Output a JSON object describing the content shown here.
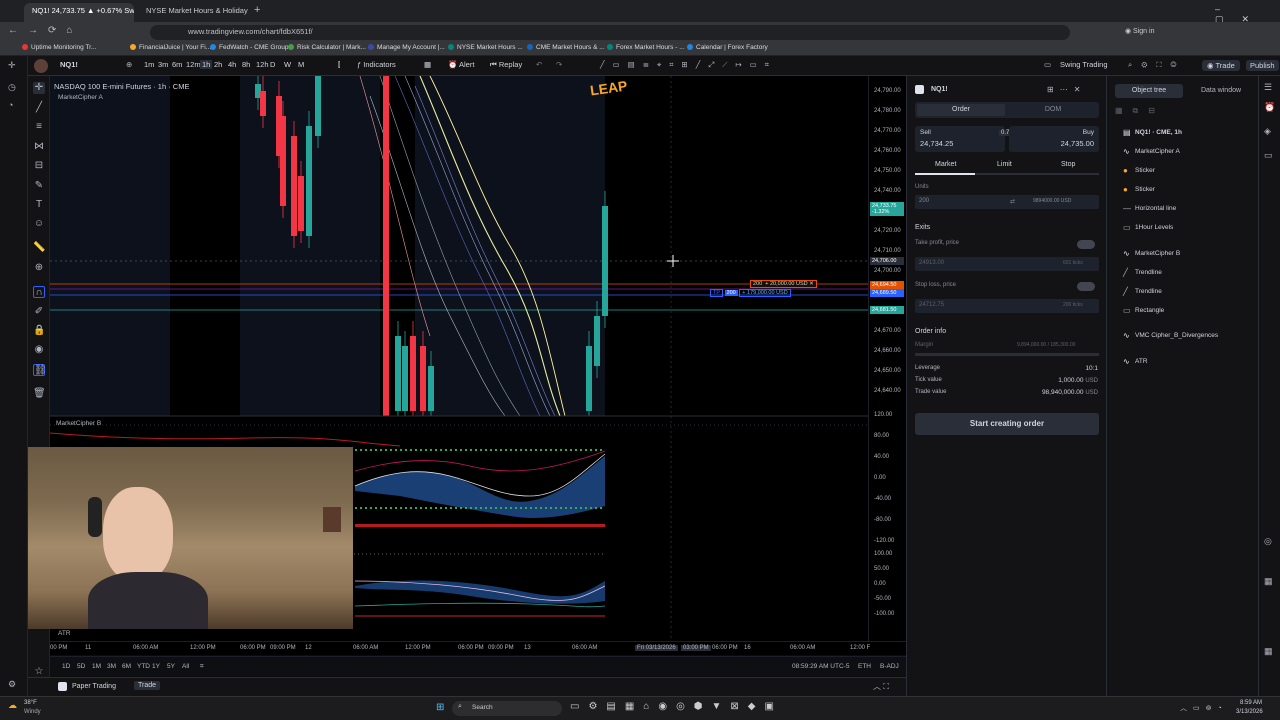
{
  "browser": {
    "tabs": [
      {
        "label": "NQ1! 24,733.75 ▲ +0.67% Swi"
      },
      {
        "label": "NYSE Market Hours & Holiday"
      }
    ],
    "url": "www.tradingview.com/chart/fdbX651f/"
  },
  "bookmarks": [
    "Uptime Monitoring Tr...",
    "FinancialJuice | Your Fi...",
    "FedWatch - CME Group",
    "Risk Calculator | Mark...",
    "Manage My Account |...",
    "NYSE Market Hours ...",
    "CME Market Hours & ...",
    "Forex Market Hours - ...",
    "Calendar | Forex Factory"
  ],
  "toolbar": {
    "symbol": "NQ1!",
    "intervals": [
      "1m",
      "3m",
      "6m",
      "12m",
      "1h",
      "2h",
      "4h",
      "8h",
      "12h",
      "D",
      "W",
      "M"
    ],
    "active_interval": "1h",
    "indicators": "Indicators",
    "alert": "Alert",
    "replay": "Replay",
    "layout": "Swing Trading",
    "layout_sub": "Save",
    "trade": "Trade",
    "publish": "Publish"
  },
  "chart": {
    "title": "NASDAQ 100 E-mini Futures · 1h · CME",
    "indicator_a": "MarketCipher A",
    "indicator_b": "MarketCipher B",
    "atr": "ATR",
    "logo": "LEAP",
    "order_line1_qty": "200",
    "order_line1_text": "+ 20,000.00 USD",
    "order_line2_qty": "200",
    "order_line2_tp": "TP",
    "order_line2_text": "+ 179,000.00 USD",
    "prices": [
      "24,790.00",
      "24,780.00",
      "24,770.00",
      "24,760.00",
      "24,750.00",
      "24,740.00",
      "24,730.00",
      "24,720.00",
      "24,710.00",
      "24,700.00",
      "24,690.00",
      "24,680.00",
      "24,670.00",
      "24,660.00",
      "24,650.00",
      "24,640.00"
    ],
    "price_tags": [
      {
        "label": "24,733.75",
        "sub": "-1.32%",
        "color": "#26a69a"
      },
      {
        "label": "24,706.00",
        "color": "#2a2e39"
      },
      {
        "label": "24,694.50",
        "color": "#e65100"
      },
      {
        "label": "24,689.50",
        "color": "#2962ff"
      },
      {
        "label": "24,681.50",
        "color": "#26a69a"
      }
    ],
    "osc_levels": [
      "120.00",
      "80.00",
      "40.00",
      "0.00",
      "-40.00",
      "-80.00",
      "-120.00"
    ],
    "osc2_levels": [
      "100.00",
      "50.00",
      "0.00",
      "-50.00",
      "-100.00"
    ],
    "time_labels": [
      "00 PM",
      "11",
      "06:00 AM",
      "12:00 PM",
      "06:00 PM",
      "09:00 PM",
      "12",
      "06:00 AM",
      "12:00 PM",
      "06:00 PM",
      "09:00 PM",
      "13",
      "06:00 AM",
      "Fri 03/13/2026",
      "03:00 PM",
      "06:00 PM",
      "16",
      "06:00 AM",
      "12:00 F"
    ],
    "ranges": [
      "1D",
      "5D",
      "1M",
      "3M",
      "6M",
      "YTD",
      "1Y",
      "5Y",
      "All"
    ],
    "clock": "08:59:29 AM UTC-5",
    "session": "ETH",
    "adj": "B-ADJ"
  },
  "order": {
    "symbol": "NQ1!",
    "tabs": [
      "Order",
      "DOM"
    ],
    "sell_label": "Sell",
    "sell_price": "24,734.25",
    "spread": "0.75",
    "buy_label": "Buy",
    "buy_price": "24,735.00",
    "types": [
      "Market",
      "Limit",
      "Stop"
    ],
    "units_label": "Units",
    "units_value": "200",
    "units_usd": "9894000.00 USD",
    "exits": "Exits",
    "tp_label": "Take profit, price",
    "tp_value": "24913.00",
    "tp_ticks": "601 ticks",
    "sl_label": "Stop loss, price",
    "sl_value": "24712.75",
    "sl_ticks": "200 ticks",
    "info_title": "Order info",
    "margin_label": "Margin",
    "margin_value": "9,894,000.00 / 185,300.00",
    "leverage_label": "Leverage",
    "leverage_value": "10:1",
    "tick_label": "Tick value",
    "tick_value": "1,000.00",
    "tick_unit": "USD",
    "trade_label": "Trade value",
    "trade_value": "98,940,000.00",
    "trade_unit": "USD",
    "submit": "Start creating order"
  },
  "objects": {
    "tabs": [
      "Object tree",
      "Data window"
    ],
    "items": [
      "NQ1! · CME, 1h",
      "MarketCipher A",
      "Sticker",
      "Sticker",
      "Horizontal line",
      "1Hour Levels",
      "MarketCipher B",
      "Trendline",
      "Trendline",
      "Rectangle",
      "VMC Cipher_B_Divergences",
      "ATR"
    ]
  },
  "bottom": {
    "paper": "Paper Trading",
    "trade": "Trade"
  },
  "taskbar": {
    "weather_temp": "38°F",
    "weather_desc": "Windy",
    "search": "Search",
    "time": "8:59 AM",
    "date": "3/13/2026"
  }
}
